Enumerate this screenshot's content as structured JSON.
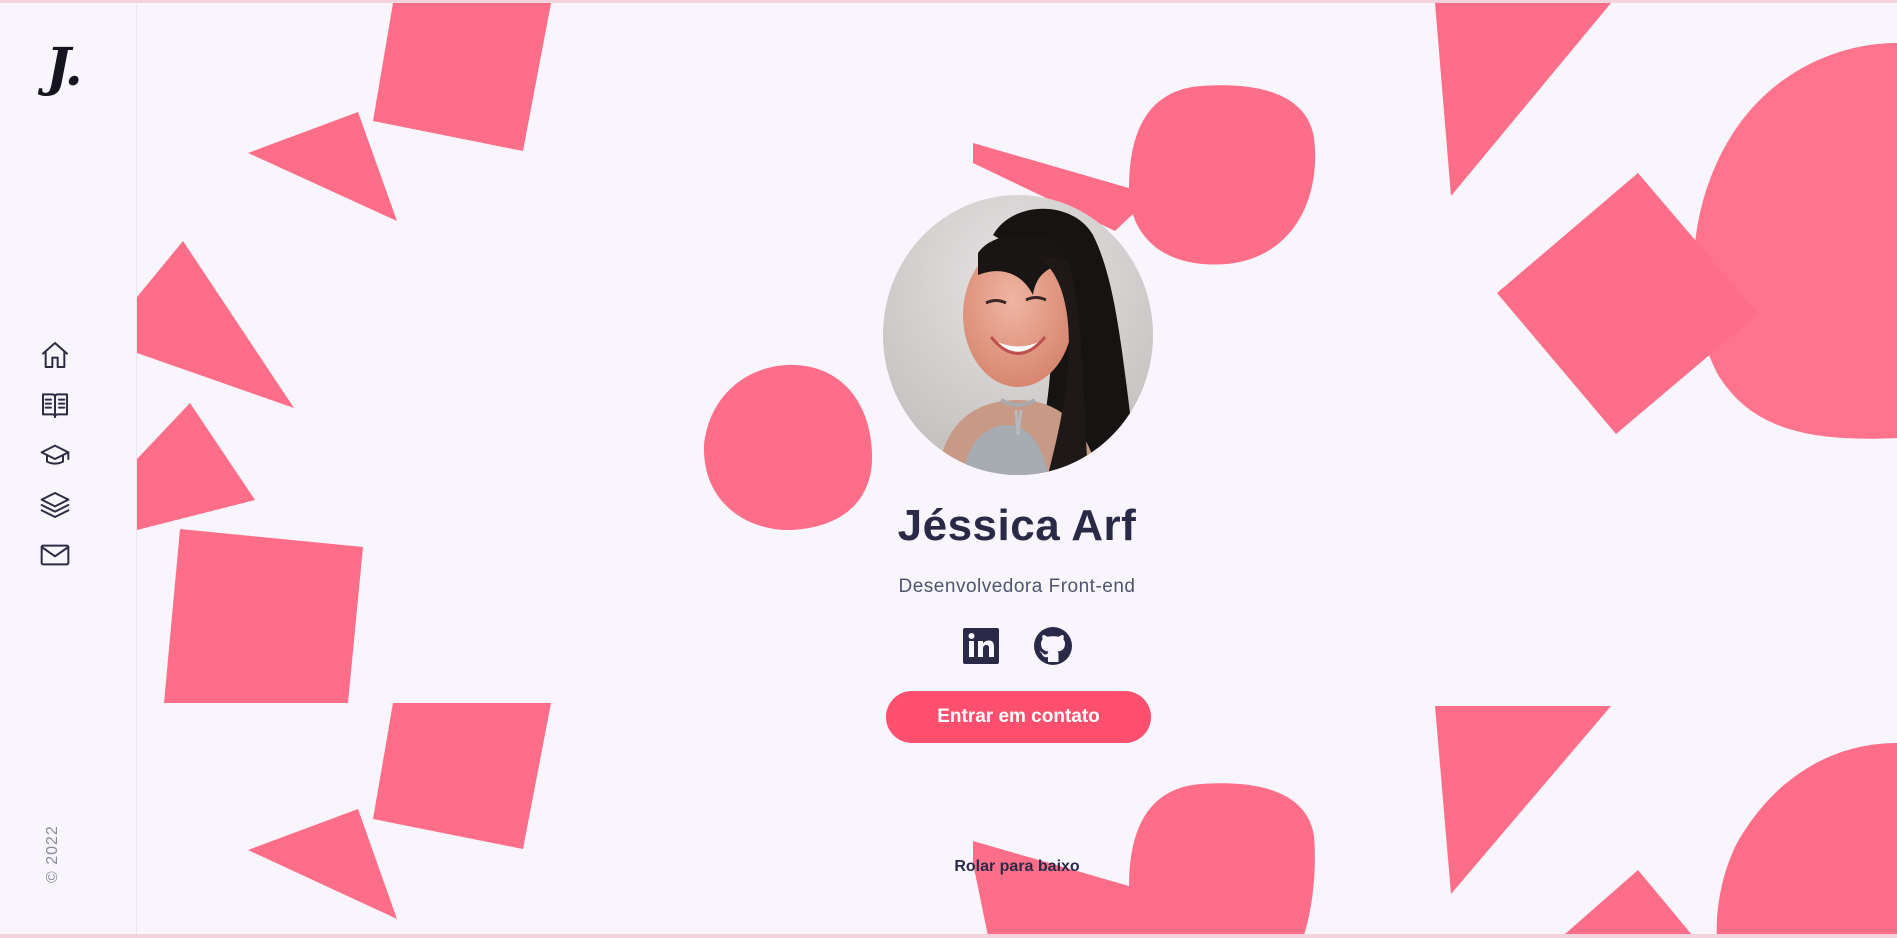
{
  "sidebar": {
    "logo": "J.",
    "nav": [
      {
        "icon": "home-icon",
        "label": "Home"
      },
      {
        "icon": "book-icon",
        "label": "Sobre"
      },
      {
        "icon": "graduation-cap-icon",
        "label": "Formação"
      },
      {
        "icon": "layers-icon",
        "label": "Projetos"
      },
      {
        "icon": "mail-icon",
        "label": "Contato"
      }
    ],
    "copyright": "© 2022"
  },
  "hero": {
    "name": "Jéssica Arf",
    "role": "Desenvolvedora Front-end",
    "socials": [
      {
        "icon": "linkedin-icon"
      },
      {
        "icon": "github-icon"
      }
    ],
    "cta_label": "Entrar em contato",
    "scroll_label": "Rolar para baixo"
  },
  "colors": {
    "background": "#f8f5fd",
    "shape": "#ff6a86",
    "accent": "#ff4f6e",
    "text": "#2a2a48"
  }
}
